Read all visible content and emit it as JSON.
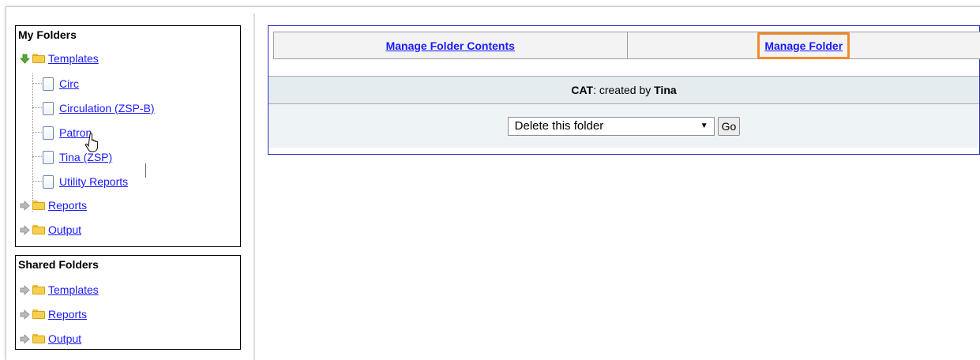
{
  "my_folders": {
    "title": "My Folders",
    "templates": "Templates",
    "items": [
      "Circ",
      "Circulation (ZSP-B)",
      "Patron",
      "Tina (ZSP)",
      "Utility Reports"
    ],
    "reports": "Reports",
    "output": "Output"
  },
  "shared_folders": {
    "title": "Shared Folders",
    "templates": "Templates",
    "reports": "Reports",
    "output": "Output"
  },
  "tabs": {
    "contents": "Manage Folder Contents",
    "folder": "Manage Folder"
  },
  "info": {
    "folder_name": "CAT",
    "created_by": ": created by ",
    "owner": "Tina"
  },
  "action": {
    "selected": "Delete this folder",
    "go": "Go"
  },
  "colors": {
    "link": "#1a1aff",
    "highlight": "#f18a2d",
    "main_border": "#2c2cc8"
  }
}
